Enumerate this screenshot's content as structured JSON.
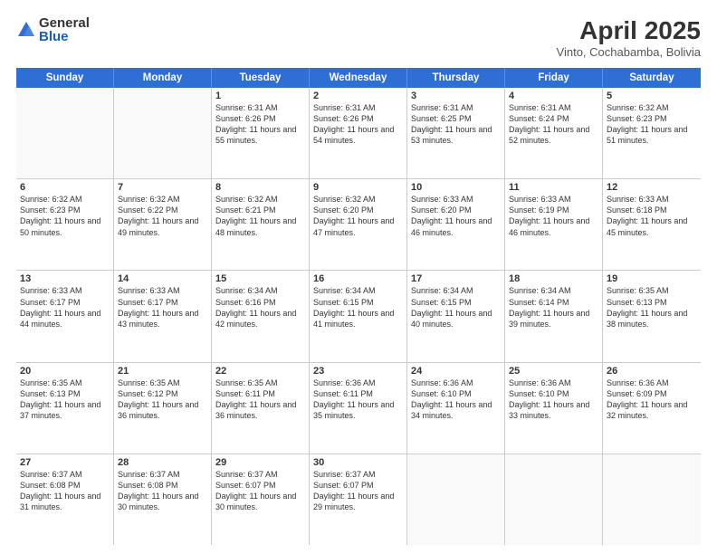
{
  "logo": {
    "general": "General",
    "blue": "Blue"
  },
  "title": "April 2025",
  "subtitle": "Vinto, Cochabamba, Bolivia",
  "days": [
    "Sunday",
    "Monday",
    "Tuesday",
    "Wednesday",
    "Thursday",
    "Friday",
    "Saturday"
  ],
  "weeks": [
    [
      {
        "day": "",
        "info": ""
      },
      {
        "day": "",
        "info": ""
      },
      {
        "day": "1",
        "info": "Sunrise: 6:31 AM\nSunset: 6:26 PM\nDaylight: 11 hours and 55 minutes."
      },
      {
        "day": "2",
        "info": "Sunrise: 6:31 AM\nSunset: 6:26 PM\nDaylight: 11 hours and 54 minutes."
      },
      {
        "day": "3",
        "info": "Sunrise: 6:31 AM\nSunset: 6:25 PM\nDaylight: 11 hours and 53 minutes."
      },
      {
        "day": "4",
        "info": "Sunrise: 6:31 AM\nSunset: 6:24 PM\nDaylight: 11 hours and 52 minutes."
      },
      {
        "day": "5",
        "info": "Sunrise: 6:32 AM\nSunset: 6:23 PM\nDaylight: 11 hours and 51 minutes."
      }
    ],
    [
      {
        "day": "6",
        "info": "Sunrise: 6:32 AM\nSunset: 6:23 PM\nDaylight: 11 hours and 50 minutes."
      },
      {
        "day": "7",
        "info": "Sunrise: 6:32 AM\nSunset: 6:22 PM\nDaylight: 11 hours and 49 minutes."
      },
      {
        "day": "8",
        "info": "Sunrise: 6:32 AM\nSunset: 6:21 PM\nDaylight: 11 hours and 48 minutes."
      },
      {
        "day": "9",
        "info": "Sunrise: 6:32 AM\nSunset: 6:20 PM\nDaylight: 11 hours and 47 minutes."
      },
      {
        "day": "10",
        "info": "Sunrise: 6:33 AM\nSunset: 6:20 PM\nDaylight: 11 hours and 46 minutes."
      },
      {
        "day": "11",
        "info": "Sunrise: 6:33 AM\nSunset: 6:19 PM\nDaylight: 11 hours and 46 minutes."
      },
      {
        "day": "12",
        "info": "Sunrise: 6:33 AM\nSunset: 6:18 PM\nDaylight: 11 hours and 45 minutes."
      }
    ],
    [
      {
        "day": "13",
        "info": "Sunrise: 6:33 AM\nSunset: 6:17 PM\nDaylight: 11 hours and 44 minutes."
      },
      {
        "day": "14",
        "info": "Sunrise: 6:33 AM\nSunset: 6:17 PM\nDaylight: 11 hours and 43 minutes."
      },
      {
        "day": "15",
        "info": "Sunrise: 6:34 AM\nSunset: 6:16 PM\nDaylight: 11 hours and 42 minutes."
      },
      {
        "day": "16",
        "info": "Sunrise: 6:34 AM\nSunset: 6:15 PM\nDaylight: 11 hours and 41 minutes."
      },
      {
        "day": "17",
        "info": "Sunrise: 6:34 AM\nSunset: 6:15 PM\nDaylight: 11 hours and 40 minutes."
      },
      {
        "day": "18",
        "info": "Sunrise: 6:34 AM\nSunset: 6:14 PM\nDaylight: 11 hours and 39 minutes."
      },
      {
        "day": "19",
        "info": "Sunrise: 6:35 AM\nSunset: 6:13 PM\nDaylight: 11 hours and 38 minutes."
      }
    ],
    [
      {
        "day": "20",
        "info": "Sunrise: 6:35 AM\nSunset: 6:13 PM\nDaylight: 11 hours and 37 minutes."
      },
      {
        "day": "21",
        "info": "Sunrise: 6:35 AM\nSunset: 6:12 PM\nDaylight: 11 hours and 36 minutes."
      },
      {
        "day": "22",
        "info": "Sunrise: 6:35 AM\nSunset: 6:11 PM\nDaylight: 11 hours and 36 minutes."
      },
      {
        "day": "23",
        "info": "Sunrise: 6:36 AM\nSunset: 6:11 PM\nDaylight: 11 hours and 35 minutes."
      },
      {
        "day": "24",
        "info": "Sunrise: 6:36 AM\nSunset: 6:10 PM\nDaylight: 11 hours and 34 minutes."
      },
      {
        "day": "25",
        "info": "Sunrise: 6:36 AM\nSunset: 6:10 PM\nDaylight: 11 hours and 33 minutes."
      },
      {
        "day": "26",
        "info": "Sunrise: 6:36 AM\nSunset: 6:09 PM\nDaylight: 11 hours and 32 minutes."
      }
    ],
    [
      {
        "day": "27",
        "info": "Sunrise: 6:37 AM\nSunset: 6:08 PM\nDaylight: 11 hours and 31 minutes."
      },
      {
        "day": "28",
        "info": "Sunrise: 6:37 AM\nSunset: 6:08 PM\nDaylight: 11 hours and 30 minutes."
      },
      {
        "day": "29",
        "info": "Sunrise: 6:37 AM\nSunset: 6:07 PM\nDaylight: 11 hours and 30 minutes."
      },
      {
        "day": "30",
        "info": "Sunrise: 6:37 AM\nSunset: 6:07 PM\nDaylight: 11 hours and 29 minutes."
      },
      {
        "day": "",
        "info": ""
      },
      {
        "day": "",
        "info": ""
      },
      {
        "day": "",
        "info": ""
      }
    ]
  ]
}
